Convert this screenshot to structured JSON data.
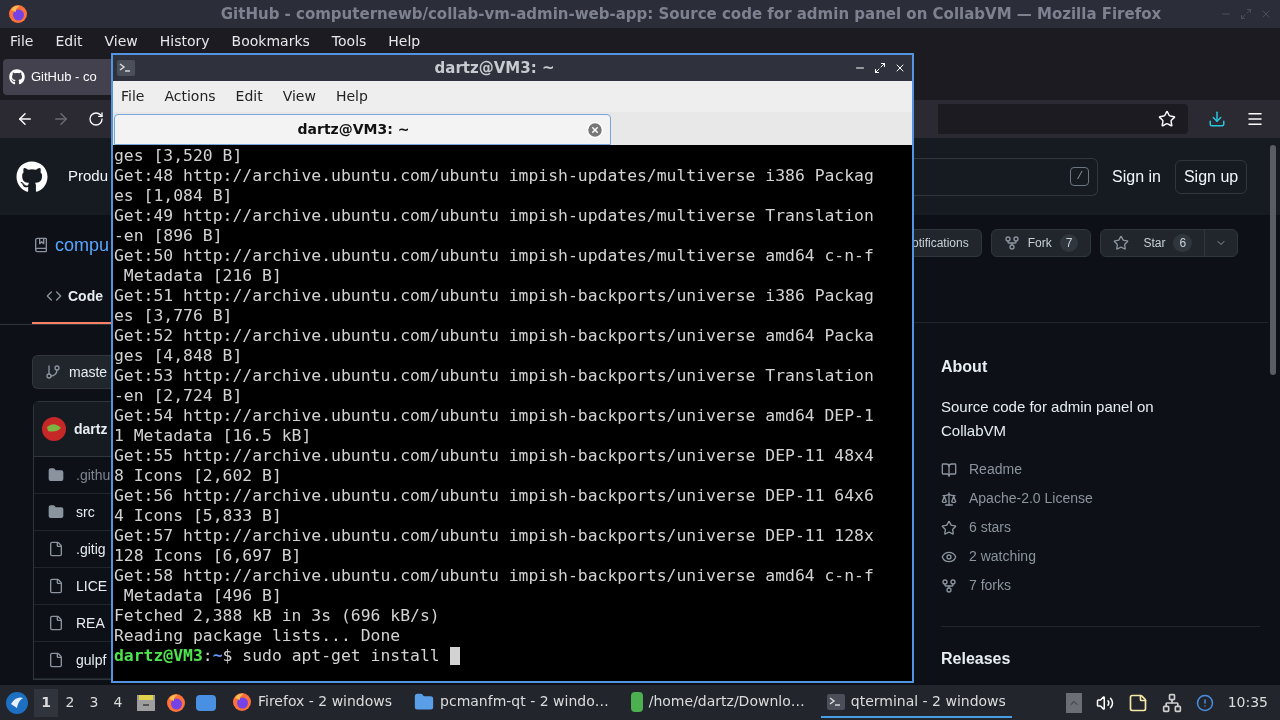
{
  "firefox": {
    "title": "GitHub - computernewb/collab-vm-admin-web-app: Source code for admin panel on CollabVM — Mozilla Firefox",
    "menu": [
      "File",
      "Edit",
      "View",
      "History",
      "Bookmarks",
      "Tools",
      "Help"
    ],
    "tab": {
      "label": "GitHub - co",
      "selected": true
    },
    "github": {
      "nav_item": "Produ",
      "search_key": "/",
      "sign_in": "Sign in",
      "sign_up": "Sign up",
      "repo_name": "compu",
      "code_tab": {
        "label": "Code",
        "selected": true
      },
      "branch": "maste",
      "commit_author": "dartz",
      "files": [
        {
          "kind": "folder",
          "name": ".githu",
          "dim": true
        },
        {
          "kind": "folder",
          "name": "src",
          "dim": false
        },
        {
          "kind": "file",
          "name": ".gitig",
          "dim": false
        },
        {
          "kind": "file",
          "name": "LICE",
          "dim": false
        },
        {
          "kind": "file",
          "name": "REA",
          "dim": false
        },
        {
          "kind": "file",
          "name": "gulpf",
          "dim": false
        }
      ],
      "notifications": "otifications",
      "fork": {
        "label": "Fork",
        "count": "7"
      },
      "star": {
        "label": "Star",
        "count": "6"
      },
      "about": {
        "title": "About",
        "description": "Source code for admin panel on CollabVM",
        "items": [
          {
            "kind": "readme",
            "label": "Readme"
          },
          {
            "kind": "license",
            "label": "Apache-2.0 License"
          },
          {
            "kind": "stars",
            "label": "6 stars"
          },
          {
            "kind": "watching",
            "label": "2 watching"
          },
          {
            "kind": "forks",
            "label": "7 forks"
          }
        ]
      },
      "releases": "Releases"
    }
  },
  "terminal": {
    "title": "dartz@VM3: ~",
    "menu": [
      "File",
      "Actions",
      "Edit",
      "View",
      "Help"
    ],
    "tab": {
      "label": "dartz@VM3: ~",
      "selected": true
    },
    "lines": [
      {
        "kind": "output",
        "text": "ges [3,520 B]"
      },
      {
        "kind": "output",
        "text": "Get:48 http://archive.ubuntu.com/ubuntu impish-updates/multiverse i386 Packag"
      },
      {
        "kind": "output",
        "text": "es [1,084 B]"
      },
      {
        "kind": "output",
        "text": "Get:49 http://archive.ubuntu.com/ubuntu impish-updates/multiverse Translation"
      },
      {
        "kind": "output",
        "text": "-en [896 B]"
      },
      {
        "kind": "output",
        "text": "Get:50 http://archive.ubuntu.com/ubuntu impish-updates/multiverse amd64 c-n-f"
      },
      {
        "kind": "output",
        "text": " Metadata [216 B]"
      },
      {
        "kind": "output",
        "text": "Get:51 http://archive.ubuntu.com/ubuntu impish-backports/universe i386 Packag"
      },
      {
        "kind": "output",
        "text": "es [3,776 B]"
      },
      {
        "kind": "output",
        "text": "Get:52 http://archive.ubuntu.com/ubuntu impish-backports/universe amd64 Packa"
      },
      {
        "kind": "output",
        "text": "ges [4,848 B]"
      },
      {
        "kind": "output",
        "text": "Get:53 http://archive.ubuntu.com/ubuntu impish-backports/universe Translation"
      },
      {
        "kind": "output",
        "text": "-en [2,724 B]"
      },
      {
        "kind": "output",
        "text": "Get:54 http://archive.ubuntu.com/ubuntu impish-backports/universe amd64 DEP-1"
      },
      {
        "kind": "output",
        "text": "1 Metadata [16.5 kB]"
      },
      {
        "kind": "output",
        "text": "Get:55 http://archive.ubuntu.com/ubuntu impish-backports/universe DEP-11 48x4"
      },
      {
        "kind": "output",
        "text": "8 Icons [2,602 B]"
      },
      {
        "kind": "output",
        "text": "Get:56 http://archive.ubuntu.com/ubuntu impish-backports/universe DEP-11 64x6"
      },
      {
        "kind": "output",
        "text": "4 Icons [5,833 B]"
      },
      {
        "kind": "output",
        "text": "Get:57 http://archive.ubuntu.com/ubuntu impish-backports/universe DEP-11 128x"
      },
      {
        "kind": "output",
        "text": "128 Icons [6,697 B]"
      },
      {
        "kind": "output",
        "text": "Get:58 http://archive.ubuntu.com/ubuntu impish-backports/universe amd64 c-n-f"
      },
      {
        "kind": "output",
        "text": " Metadata [496 B]"
      },
      {
        "kind": "output",
        "text": "Fetched 2,388 kB in 3s (696 kB/s)"
      },
      {
        "kind": "output",
        "text": "Reading package lists... Done"
      },
      {
        "kind": "prompt",
        "user": "dartz@VM3",
        "sep": ":",
        "path": "~",
        "command": "$ sudo apt-get install",
        "cursor": true
      }
    ]
  },
  "taskbar": {
    "workspaces": [
      {
        "label": "1",
        "selected": true
      },
      {
        "label": "2",
        "selected": false
      },
      {
        "label": "3",
        "selected": false
      },
      {
        "label": "4",
        "selected": false
      }
    ],
    "tasks": [
      {
        "kind": "firefox",
        "label": "Firefox - 2 windows",
        "selected": false
      },
      {
        "kind": "folder",
        "label": "pcmanfm-qt - 2 windo…",
        "selected": false
      },
      {
        "kind": "archive",
        "label": "/home/dartz/Downlo…",
        "selected": false
      },
      {
        "kind": "terminal",
        "label": "qterminal - 2 windows",
        "selected": true
      }
    ],
    "clock": "10:35"
  }
}
